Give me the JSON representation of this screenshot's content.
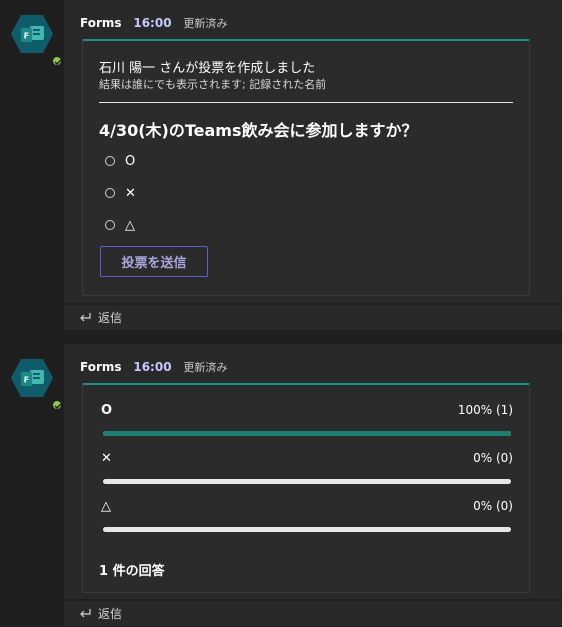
{
  "colors": {
    "accent": "#19937f",
    "bar_fill": "#1b7f70",
    "button_border": "#5b5fc7",
    "time": "#c7c9ff",
    "presence": "#92c353"
  },
  "post1": {
    "sender": "Forms",
    "time": "16:00",
    "edited": "更新済み",
    "avatar_icon": "forms-app-icon",
    "card": {
      "creator_line": "石川 陽一 さんが投票を作成しました",
      "visibility_line": "結果は誰にでも表示されます; 記録された名前",
      "question": "4/30(木)のTeams飲み会に参加しますか？",
      "options": [
        {
          "label": "O"
        },
        {
          "label": "✕"
        },
        {
          "label": "△"
        }
      ],
      "submit_label": "投票を送信"
    },
    "reply_label": "返信"
  },
  "post2": {
    "sender": "Forms",
    "time": "16:00",
    "edited": "更新済み",
    "avatar_icon": "forms-app-icon",
    "results": [
      {
        "label": "O",
        "value_text": "100% (1)",
        "fraction": 1.0
      },
      {
        "label": "✕",
        "value_text": "0% (0)",
        "fraction": 0.0
      },
      {
        "label": "△",
        "value_text": "0% (0)",
        "fraction": 0.0
      }
    ],
    "response_count": "1 件の回答",
    "reply_label": "返信"
  }
}
